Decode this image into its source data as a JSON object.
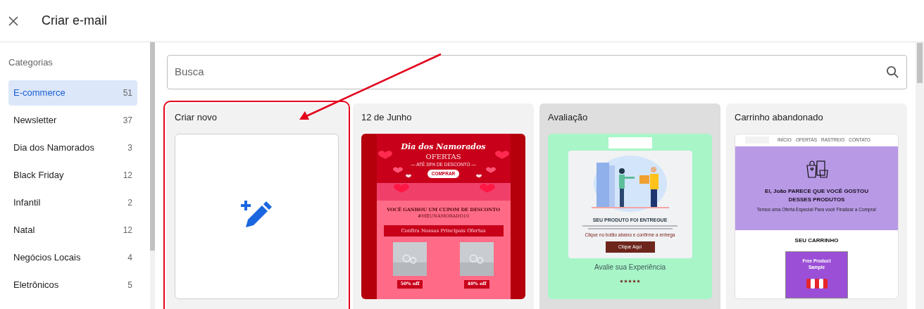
{
  "header": {
    "title": "Criar e-mail"
  },
  "sidebar": {
    "heading": "Categorias",
    "items": [
      {
        "label": "E-commerce",
        "count": "51",
        "selected": true
      },
      {
        "label": "Newsletter",
        "count": "37",
        "selected": false
      },
      {
        "label": "Dia dos Namorados",
        "count": "3",
        "selected": false
      },
      {
        "label": "Black Friday",
        "count": "12",
        "selected": false
      },
      {
        "label": "Infantil",
        "count": "2",
        "selected": false
      },
      {
        "label": "Natal",
        "count": "12",
        "selected": false
      },
      {
        "label": "Negócios Locais",
        "count": "4",
        "selected": false
      },
      {
        "label": "Eletrônicos",
        "count": "5",
        "selected": false
      }
    ]
  },
  "search": {
    "placeholder": "Busca"
  },
  "templates": [
    {
      "kind": "new",
      "title": "Criar novo",
      "highlighted": false,
      "outlined": true
    },
    {
      "kind": "valentine",
      "title": "12 de Junho",
      "highlighted": false,
      "outlined": false,
      "texts": {
        "headline": "Dia dos Namorados",
        "offer": "OFERTAS",
        "discount": "— ATÉ 30% DE DESCONTO —",
        "button": "COMPRAR",
        "coupon": "VOCÊ GANHOU UM CUPOM DE DESCONTO",
        "code": "#MEUNAMORADO10",
        "banner": "Confira Nossas Principais Ofertas"
      },
      "products": [
        "50% off",
        "40% off"
      ]
    },
    {
      "kind": "review",
      "title": "Avaliação",
      "highlighted": true,
      "outlined": false,
      "texts": {
        "headline": "SEU PRODUTO FOI ENTREGUE",
        "prompt": "Clique no botão abaixo e confirme a entrega",
        "button": "Clique Aqui",
        "rate": "Avalie sua Experiência"
      },
      "stars": 5
    },
    {
      "kind": "cart",
      "title": "Carrinho abandonado",
      "highlighted": false,
      "outlined": false,
      "nav": [
        "INÍCIO",
        "OFERTAS",
        "RASTREIO",
        "CONTATO"
      ],
      "texts": {
        "headline": "Ei, João PARECE QUE VOCÊ GOSTOU DESSES PRODUTOS",
        "subline": "Temos uma Oferta Especial Para você Finalizar a Compra!",
        "section": "SEU CARRINHO",
        "sample": "Free Product Sample"
      }
    }
  ]
}
